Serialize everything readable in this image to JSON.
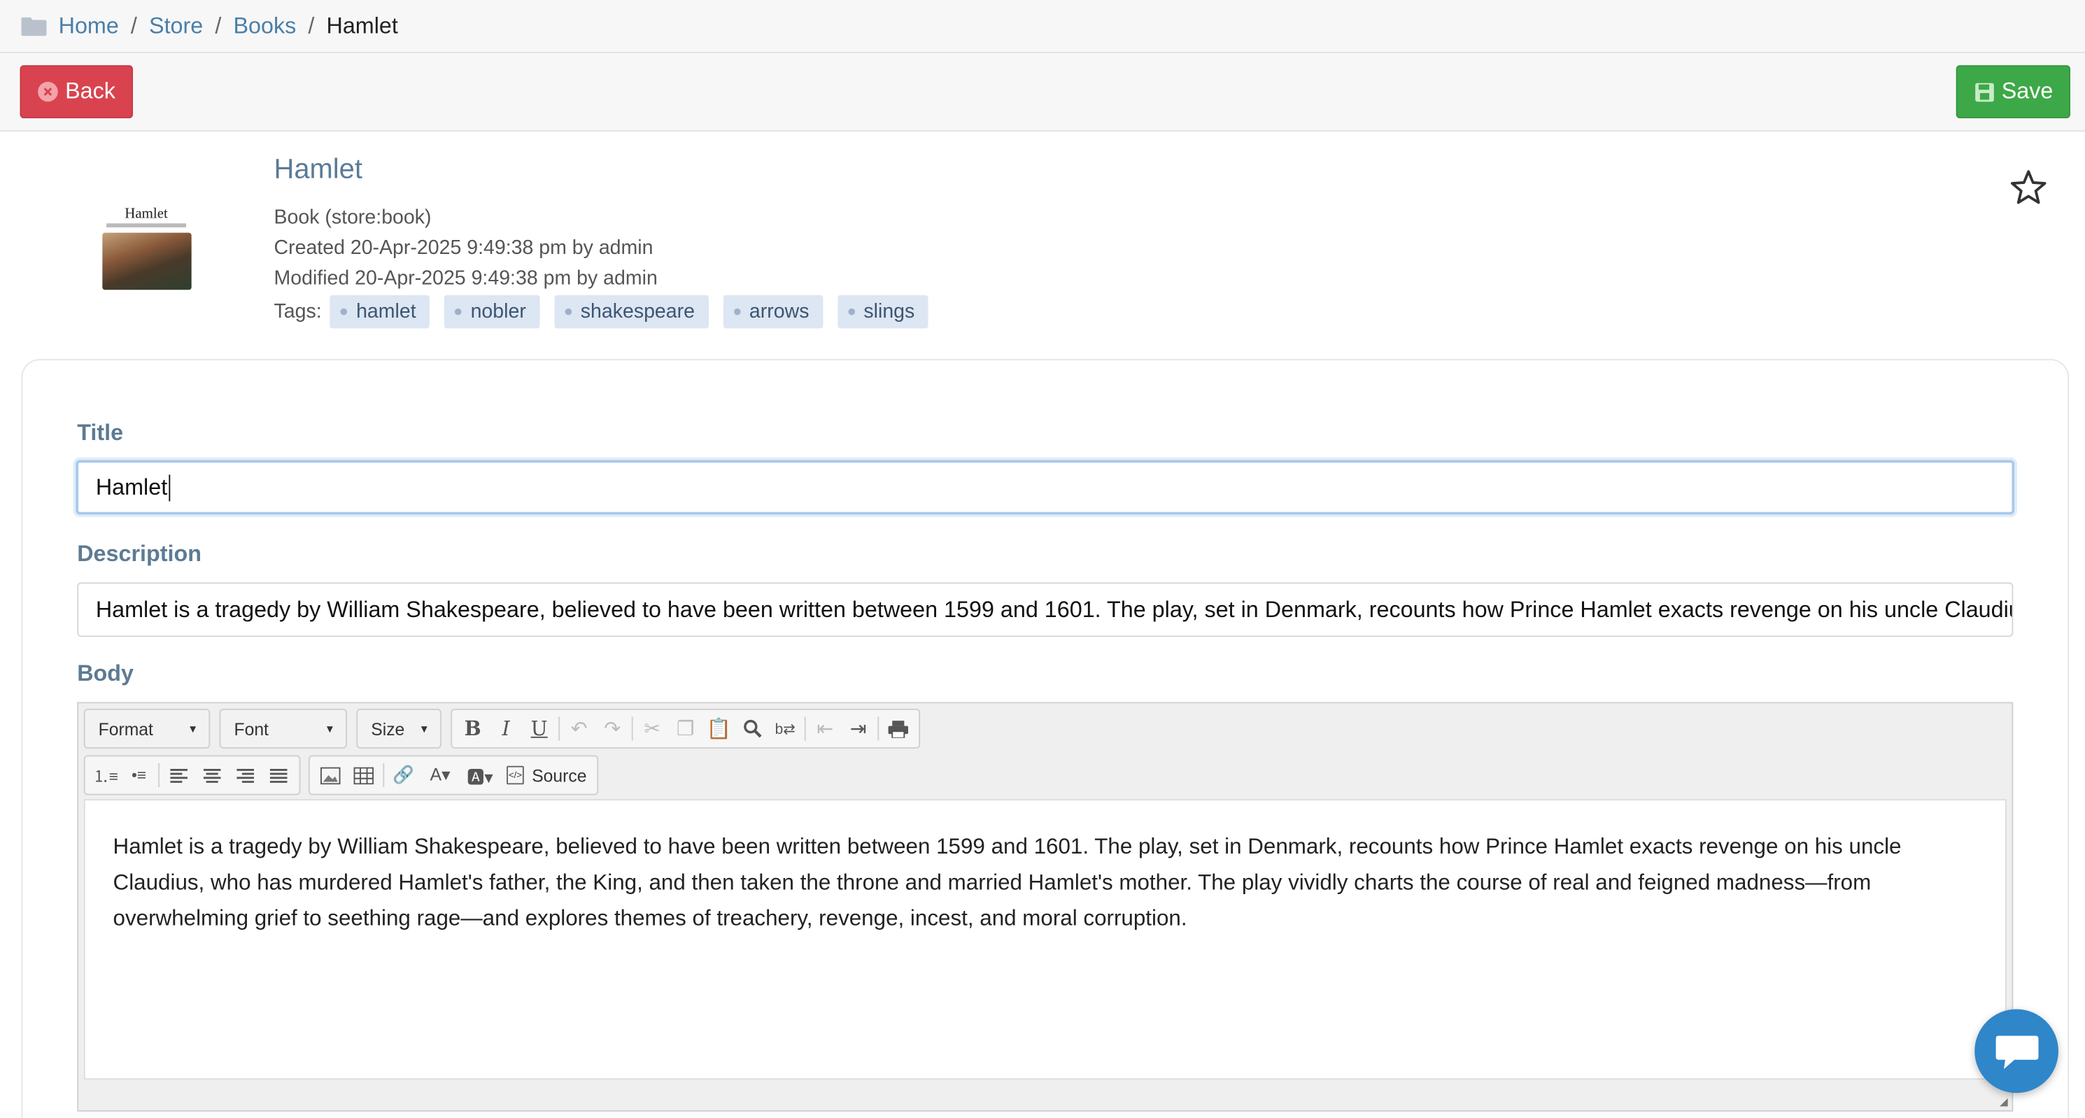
{
  "breadcrumb": {
    "items": [
      "Home",
      "Store",
      "Books"
    ],
    "current": "Hamlet"
  },
  "toolbar": {
    "back_label": "Back",
    "save_label": "Save"
  },
  "object": {
    "cover_title": "Hamlet",
    "title": "Hamlet",
    "type_line": "Book (store:book)",
    "created_line": "Created 20-Apr-2025 9:49:38 pm by admin",
    "modified_line": "Modified 20-Apr-2025 9:49:38 pm by admin",
    "tags_label": "Tags:",
    "tags": [
      "hamlet",
      "nobler",
      "shakespeare",
      "arrows",
      "slings"
    ]
  },
  "form": {
    "title_label": "Title",
    "title_value": "Hamlet",
    "description_label": "Description",
    "description_value": "Hamlet is a tragedy by William Shakespeare, believed to have been written between 1599 and 1601. The play, set in Denmark, recounts how Prince Hamlet exacts revenge on his uncle Claudius",
    "body_label": "Body"
  },
  "editor": {
    "format_label": "Format",
    "font_label": "Font",
    "size_label": "Size",
    "source_label": "Source",
    "content": "Hamlet is a tragedy by William Shakespeare, believed to have been written between 1599 and 1601. The play, set in Denmark, recounts how Prince Hamlet exacts revenge on his uncle Claudius, who has murdered Hamlet's father, the King, and then taken the throne and married Hamlet's mother. The play vividly charts the course of real and feigned madness—from overwhelming grief to seething rage—and explores themes of treachery, revenge, incest, and moral corruption."
  },
  "colors": {
    "back_button": "#d9434f",
    "save_button": "#3da847",
    "link": "#4a7fa8",
    "tag_bg": "#dde6f3",
    "chat_bubble": "#2f86c9"
  }
}
